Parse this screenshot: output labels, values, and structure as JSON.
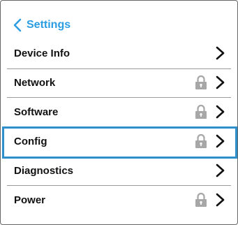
{
  "header": {
    "back_label": "Settings"
  },
  "menu": {
    "items": [
      {
        "label": "Device Info",
        "locked": false,
        "selected": false
      },
      {
        "label": "Network",
        "locked": true,
        "selected": false
      },
      {
        "label": "Software",
        "locked": true,
        "selected": false
      },
      {
        "label": "Config",
        "locked": true,
        "selected": true
      },
      {
        "label": "Diagnostics",
        "locked": false,
        "selected": false
      },
      {
        "label": "Power",
        "locked": true,
        "selected": false
      }
    ]
  },
  "colors": {
    "accent": "#2b9de3",
    "selection": "#2f8fca",
    "lock": "#a7a7a7",
    "text": "#111111",
    "divider": "#9a9a9a"
  }
}
